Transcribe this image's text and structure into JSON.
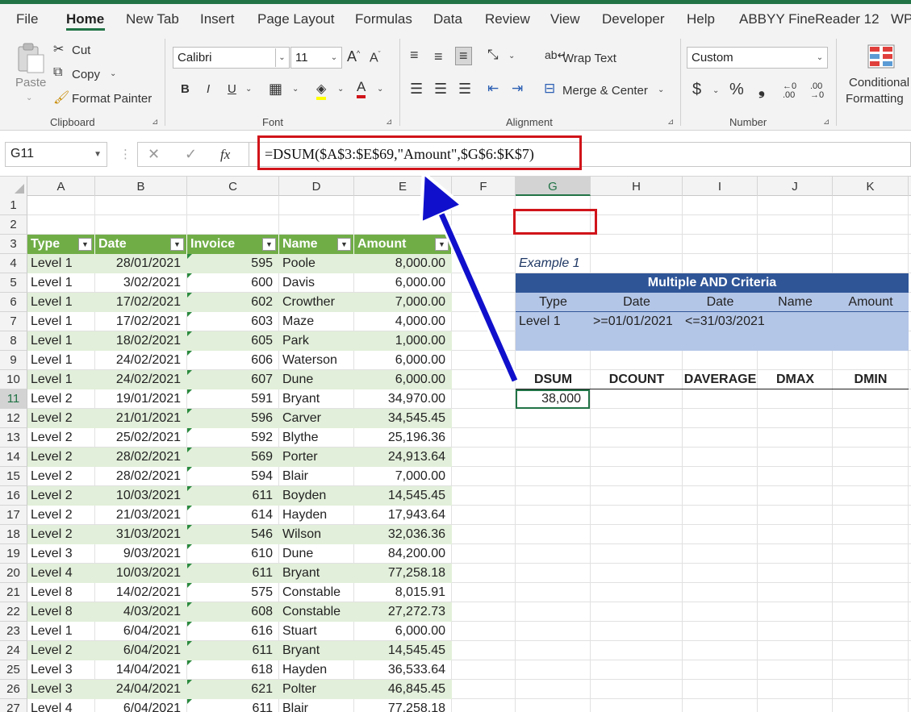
{
  "menu": {
    "tabs": [
      "File",
      "Home",
      "New Tab",
      "Insert",
      "Page Layout",
      "Formulas",
      "Data",
      "Review",
      "View",
      "Developer",
      "Help",
      "ABBYY FineReader 12",
      "WP"
    ],
    "active": "Home"
  },
  "ribbon": {
    "clipboard": {
      "paste": "Paste",
      "cut": "Cut",
      "copy": "Copy",
      "format_painter": "Format Painter",
      "group": "Clipboard"
    },
    "font": {
      "name": "Calibri",
      "size": "11",
      "bold": "B",
      "italic": "I",
      "underline": "U",
      "group": "Font"
    },
    "alignment": {
      "wrap_text": "Wrap Text",
      "merge_center": "Merge & Center",
      "group": "Alignment"
    },
    "number": {
      "format": "Custom",
      "currency": "$",
      "percent": "%",
      "comma": "❟",
      "group": "Number"
    },
    "styles": {
      "conditional_line1": "Conditional",
      "conditional_line2": "Formatting"
    }
  },
  "formula_bar": {
    "name_box": "G11",
    "fx": "fx",
    "formula": "=DSUM($A$3:$E$69,\"Amount\",$G$6:$K$7)"
  },
  "columns": [
    "A",
    "B",
    "C",
    "D",
    "E",
    "F",
    "G",
    "H",
    "I",
    "J",
    "K"
  ],
  "selected_column": "G",
  "selected_row": 11,
  "rows": [
    1,
    2,
    3,
    4,
    5,
    6,
    7,
    8,
    9,
    10,
    11,
    12,
    13,
    14,
    15,
    16,
    17,
    18,
    19,
    20,
    21,
    22,
    23,
    24,
    25,
    26,
    27
  ],
  "table": {
    "headers": [
      "Type",
      "Date",
      "Invoice",
      "Name",
      "Amount"
    ],
    "rows": [
      [
        "Level 1",
        "28/01/2021",
        "595",
        "Poole",
        "8,000.00"
      ],
      [
        "Level 1",
        "3/02/2021",
        "600",
        "Davis",
        "6,000.00"
      ],
      [
        "Level 1",
        "17/02/2021",
        "602",
        "Crowther",
        "7,000.00"
      ],
      [
        "Level 1",
        "17/02/2021",
        "603",
        "Maze",
        "4,000.00"
      ],
      [
        "Level 1",
        "18/02/2021",
        "605",
        "Park",
        "1,000.00"
      ],
      [
        "Level 1",
        "24/02/2021",
        "606",
        "Waterson",
        "6,000.00"
      ],
      [
        "Level 1",
        "24/02/2021",
        "607",
        "Dune",
        "6,000.00"
      ],
      [
        "Level 2",
        "19/01/2021",
        "591",
        "Bryant",
        "34,970.00"
      ],
      [
        "Level 2",
        "21/01/2021",
        "596",
        "Carver",
        "34,545.45"
      ],
      [
        "Level 2",
        "25/02/2021",
        "592",
        "Blythe",
        "25,196.36"
      ],
      [
        "Level 2",
        "28/02/2021",
        "569",
        "Porter",
        "24,913.64"
      ],
      [
        "Level 2",
        "28/02/2021",
        "594",
        "Blair",
        "7,000.00"
      ],
      [
        "Level 2",
        "10/03/2021",
        "611",
        "Boyden",
        "14,545.45"
      ],
      [
        "Level 2",
        "21/03/2021",
        "614",
        "Hayden",
        "17,943.64"
      ],
      [
        "Level 2",
        "31/03/2021",
        "546",
        "Wilson",
        "32,036.36"
      ],
      [
        "Level 3",
        "9/03/2021",
        "610",
        "Dune",
        "84,200.00"
      ],
      [
        "Level 4",
        "10/03/2021",
        "611",
        "Bryant",
        "77,258.18"
      ],
      [
        "Level 8",
        "14/02/2021",
        "575",
        "Constable",
        "8,015.91"
      ],
      [
        "Level 8",
        "4/03/2021",
        "608",
        "Constable",
        "27,272.73"
      ],
      [
        "Level 1",
        "6/04/2021",
        "616",
        "Stuart",
        "6,000.00"
      ],
      [
        "Level 2",
        "6/04/2021",
        "611",
        "Bryant",
        "14,545.45"
      ],
      [
        "Level 3",
        "14/04/2021",
        "618",
        "Hayden",
        "36,533.64"
      ],
      [
        "Level 3",
        "24/04/2021",
        "621",
        "Polter",
        "46,845.45"
      ],
      [
        "Level 4",
        "6/04/2021",
        "611",
        "Blair",
        "77,258.18"
      ]
    ]
  },
  "example": {
    "label": "Example 1",
    "title": "Multiple AND Criteria",
    "criteria_headers": [
      "Type",
      "Date",
      "Date",
      "Name",
      "Amount"
    ],
    "criteria_values": [
      "Level 1",
      ">=01/01/2021",
      "<=31/03/2021",
      "",
      ""
    ],
    "function_headers": [
      "DSUM",
      "DCOUNT",
      "DAVERAGE",
      "DMAX",
      "DMIN"
    ],
    "result": "38,000"
  },
  "colors": {
    "excel_green": "#217346",
    "table_header": "#70ad47",
    "band": "#e2efda",
    "criteria_title": "#2f5597",
    "criteria_bg": "#b4c6e7",
    "highlight": "#d0141a",
    "arrow": "#1010cc"
  }
}
